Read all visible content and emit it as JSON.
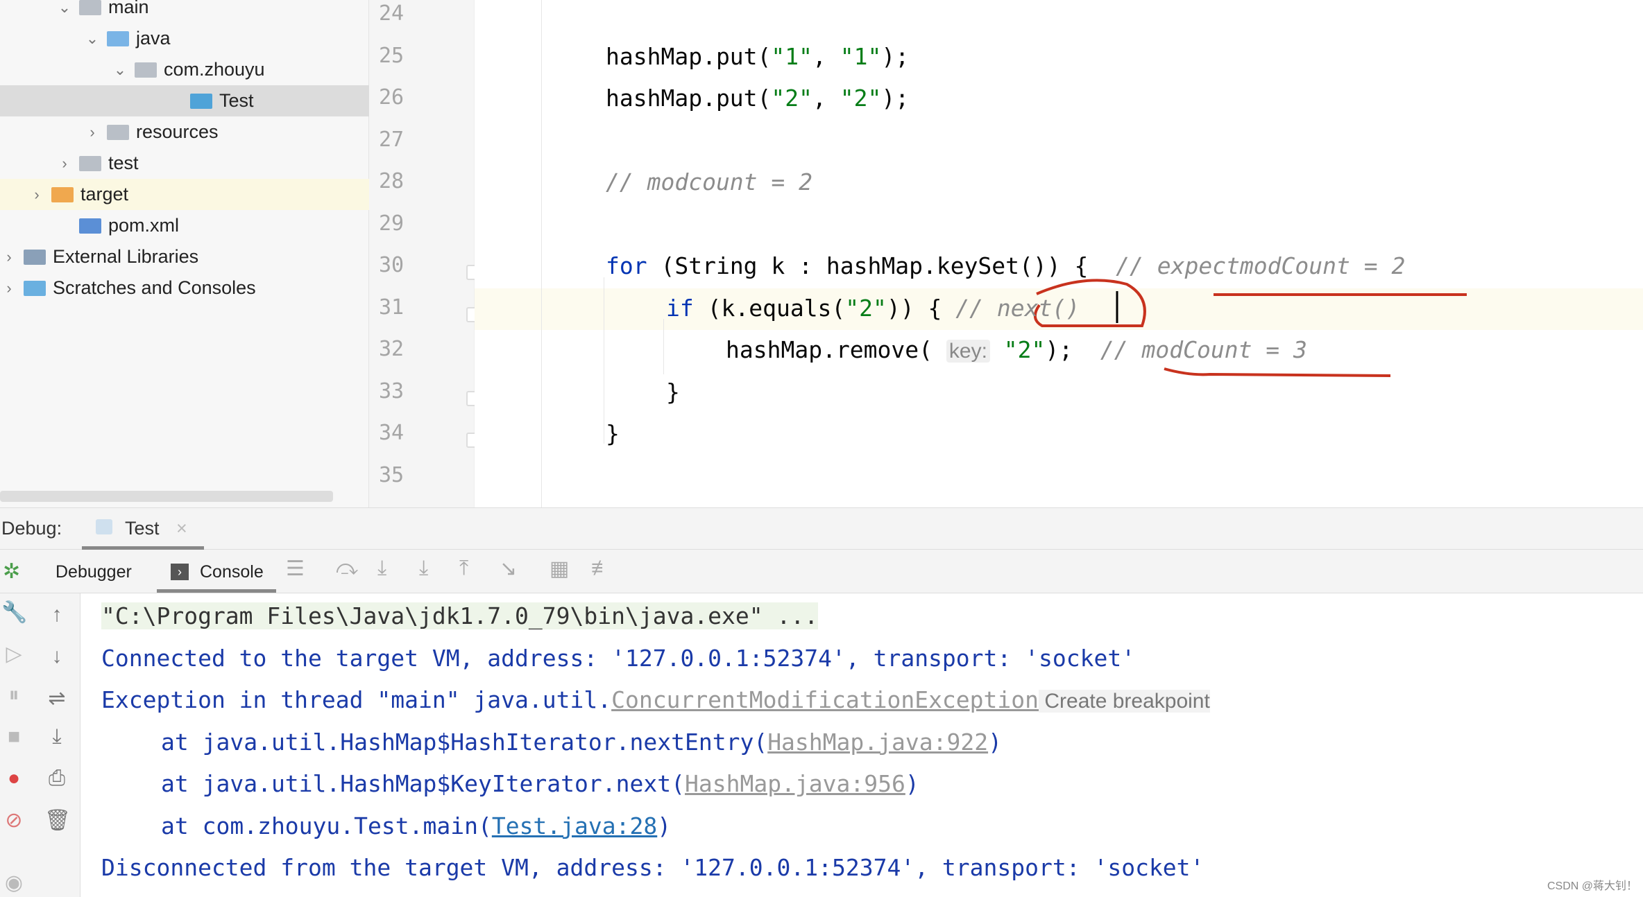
{
  "tree": [
    {
      "label": "main",
      "depth": 3,
      "chev": "⌄",
      "icon": "folder-icon",
      "color": "#b9bfc7"
    },
    {
      "label": "java",
      "depth": 4,
      "chev": "⌄",
      "icon": "folder-icon",
      "color": "#7ab4e6"
    },
    {
      "label": "com.zhouyu",
      "depth": 5,
      "chev": "⌄",
      "icon": "package-icon",
      "color": "#b9bfc7"
    },
    {
      "label": "Test",
      "depth": 7,
      "chev": "",
      "icon": "class-icon",
      "color": "#4fa3d8",
      "sel": true
    },
    {
      "label": "resources",
      "depth": 4,
      "chev": "›",
      "icon": "folder-icon",
      "color": "#b9bfc7"
    },
    {
      "label": "test",
      "depth": 3,
      "chev": "›",
      "icon": "folder-icon",
      "color": "#b9bfc7"
    },
    {
      "label": "target",
      "depth": 2,
      "chev": "›",
      "icon": "folder-icon",
      "color": "#f0a84e",
      "hl": true
    },
    {
      "label": "pom.xml",
      "depth": 3,
      "chev": "",
      "icon": "maven-icon",
      "color": "#5b8fd6"
    },
    {
      "label": "External Libraries",
      "depth": 1,
      "chev": "›",
      "icon": "libraries-icon",
      "color": "#8aa0b8"
    },
    {
      "label": "Scratches and Consoles",
      "depth": 1,
      "chev": "›",
      "icon": "scratches-icon",
      "color": "#6ab0e0"
    }
  ],
  "line_numbers": [
    "24",
    "25",
    "26",
    "27",
    "28",
    "29",
    "30",
    "31",
    "32",
    "33",
    "34",
    "35"
  ],
  "code": [
    {
      "line": 1,
      "indent": 1,
      "tokens": [
        [
          "hashMap.put(",
          ""
        ],
        [
          "\"1\"",
          "str"
        ],
        [
          ", ",
          ""
        ],
        [
          "\"1\"",
          "str"
        ],
        [
          ");",
          ""
        ]
      ]
    },
    {
      "line": 2,
      "indent": 1,
      "tokens": [
        [
          "hashMap.put(",
          ""
        ],
        [
          "\"2\"",
          "str"
        ],
        [
          ", ",
          ""
        ],
        [
          "\"2\"",
          "str"
        ],
        [
          ");",
          ""
        ]
      ]
    },
    {
      "line": 4,
      "indent": 1,
      "tokens": [
        [
          "// modcount = 2",
          "cm"
        ]
      ]
    },
    {
      "line": 6,
      "indent": 1,
      "tokens": [
        [
          "for",
          "kw"
        ],
        [
          " (String k : hashMap.keySet()) {  ",
          ""
        ],
        [
          "// expectmodCount = 2",
          "cm"
        ]
      ]
    },
    {
      "line": 7,
      "indent": 2,
      "tokens": [
        [
          "if",
          "kw"
        ],
        [
          " (k.equals(",
          ""
        ],
        [
          "\"2\"",
          "str"
        ],
        [
          ")) { ",
          ""
        ],
        [
          "// next()",
          "cm"
        ]
      ]
    },
    {
      "line": 8,
      "indent": 3,
      "tokens": [
        [
          "hashMap.remove( ",
          ""
        ],
        [
          "key:",
          "hint"
        ],
        [
          " ",
          ""
        ],
        [
          "\"2\"",
          "str"
        ],
        [
          ");  ",
          ""
        ],
        [
          "// modCount = 3",
          "cm"
        ]
      ]
    },
    {
      "line": 9,
      "indent": 2,
      "tokens": [
        [
          "}",
          ""
        ]
      ]
    },
    {
      "line": 10,
      "indent": 1,
      "tokens": [
        [
          "}",
          ""
        ]
      ]
    }
  ],
  "debug": {
    "label": "Debug:",
    "tab": "Test",
    "close": "×"
  },
  "toolbar": {
    "debugger": "Debugger",
    "console": "Console"
  },
  "console": [
    {
      "indent": 0,
      "tokens": [
        [
          "\"C:\\Program Files\\Java\\jdk1.7.0_79\\bin\\java.exe\" ...",
          "cmd"
        ]
      ]
    },
    {
      "indent": 0,
      "tokens": [
        [
          "Connected to the target VM, address: '127.0.0.1:52374', transport: 'socket'",
          ""
        ]
      ]
    },
    {
      "indent": 0,
      "tokens": [
        [
          "Exception in thread \"main\" java.util.",
          ""
        ],
        [
          "ConcurrentModificationException",
          "link"
        ],
        [
          " Create breakpoint",
          "bp"
        ]
      ]
    },
    {
      "indent": 1,
      "tokens": [
        [
          "at java.util.HashMap$HashIterator.nextEntry(",
          ""
        ],
        [
          "HashMap.java:922",
          "link"
        ],
        [
          ")",
          ""
        ]
      ]
    },
    {
      "indent": 1,
      "tokens": [
        [
          "at java.util.HashMap$KeyIterator.next(",
          ""
        ],
        [
          "HashMap.java:956",
          "link"
        ],
        [
          ")",
          ""
        ]
      ]
    },
    {
      "indent": 1,
      "tokens": [
        [
          "at com.zhouyu.Test.main(",
          ""
        ],
        [
          "Test.java:28",
          "link2"
        ],
        [
          ")",
          ""
        ]
      ]
    },
    {
      "indent": 0,
      "tokens": [
        [
          "Disconnected from the target VM, address: '127.0.0.1:52374', transport: 'socket'",
          ""
        ]
      ]
    }
  ],
  "annotation_color": "#c8321e",
  "watermark": "CSDN @蒋大钊！"
}
